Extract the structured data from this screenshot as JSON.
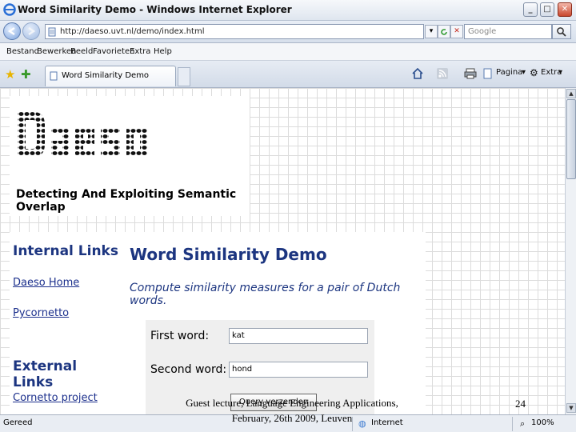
{
  "window": {
    "title": "Word Similarity Demo - Windows Internet Explorer",
    "minimize": "_",
    "maximize": "□",
    "close": "✕"
  },
  "address_bar": {
    "url": "http://daeso.uvt.nl/demo/index.html",
    "search_placeholder": "Google"
  },
  "menu": [
    "Bestand",
    "Bewerken",
    "Beeld",
    "Favorieten",
    "Extra",
    "Help"
  ],
  "tab": {
    "label": "Word Similarity Demo"
  },
  "toolbar": {
    "page_label": "Pagina",
    "tools_label": "Extra"
  },
  "page": {
    "logo_text": "Daeso",
    "tagline": "Detecting And Exploiting Semantic Overlap",
    "sidebar": {
      "internal_heading": "Internal Links",
      "internal_links": [
        "Daeso Home",
        "Pycornetto"
      ],
      "external_heading": "External Links",
      "external_links": [
        "Cornetto project"
      ]
    },
    "main": {
      "title": "Word Similarity Demo",
      "subtitle": "Compute similarity measures for a pair of Dutch words.",
      "first_word_label": "First word:",
      "first_word_value": "kat",
      "second_word_label": "Second word:",
      "second_word_value": "hond",
      "submit_label": "Query verzenden"
    }
  },
  "statusbar": {
    "status": "Gereed",
    "zone": "Internet",
    "zoom": "100%"
  },
  "slide": {
    "footer_line1": "Guest lecture, Language Engineering Applications,",
    "footer_line2": "February, 26th 2009, Leuven",
    "page_number": "24"
  }
}
